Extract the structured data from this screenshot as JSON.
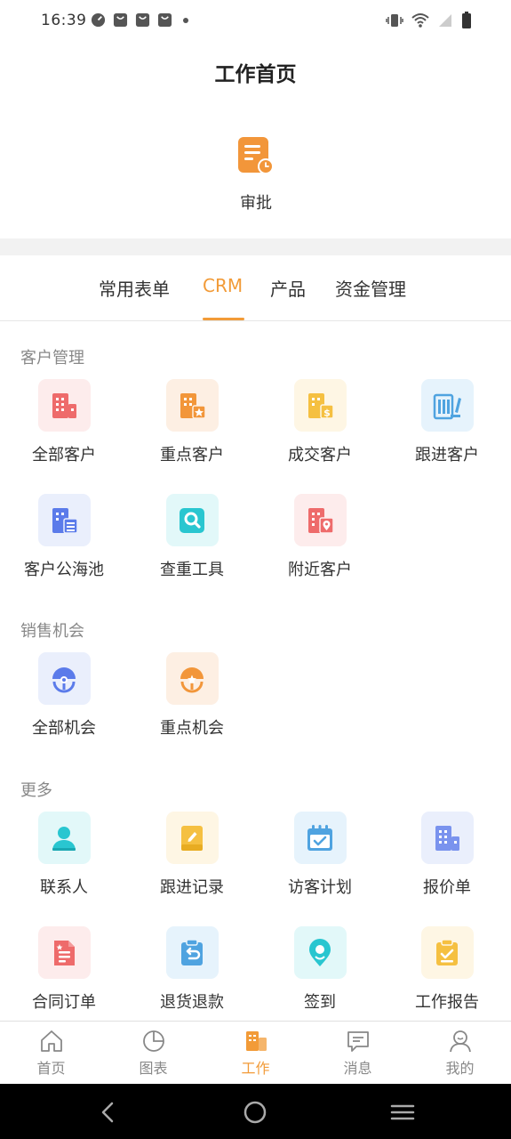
{
  "status_bar": {
    "time": "16:39"
  },
  "header": {
    "title": "工作首页"
  },
  "approval": {
    "label": "审批"
  },
  "tabs": [
    {
      "label": "常用表单"
    },
    {
      "label": "CRM"
    },
    {
      "label": "产品"
    },
    {
      "label": "资金管理"
    }
  ],
  "sections": {
    "customer": {
      "title": "客户管理",
      "items": [
        {
          "label": "全部客户"
        },
        {
          "label": "重点客户"
        },
        {
          "label": "成交客户"
        },
        {
          "label": "跟进客户"
        },
        {
          "label": "客户公海池"
        },
        {
          "label": "查重工具"
        },
        {
          "label": "附近客户"
        }
      ]
    },
    "sales": {
      "title": "销售机会",
      "items": [
        {
          "label": "全部机会"
        },
        {
          "label": "重点机会"
        }
      ]
    },
    "more": {
      "title": "更多",
      "items": [
        {
          "label": "联系人"
        },
        {
          "label": "跟进记录"
        },
        {
          "label": "访客计划"
        },
        {
          "label": "报价单"
        },
        {
          "label": "合同订单"
        },
        {
          "label": "退货退款"
        },
        {
          "label": "签到"
        },
        {
          "label": "工作报告"
        }
      ]
    }
  },
  "bottom_nav": [
    {
      "label": "首页"
    },
    {
      "label": "图表"
    },
    {
      "label": "工作"
    },
    {
      "label": "消息"
    },
    {
      "label": "我的"
    }
  ],
  "colors": {
    "accent": "#f29b38",
    "red": "#ee6b6b",
    "orange": "#f2963a",
    "yellow": "#f5c041",
    "blue": "#4fa3e0",
    "indigo": "#5b7bea",
    "cyan": "#29c6d0"
  }
}
